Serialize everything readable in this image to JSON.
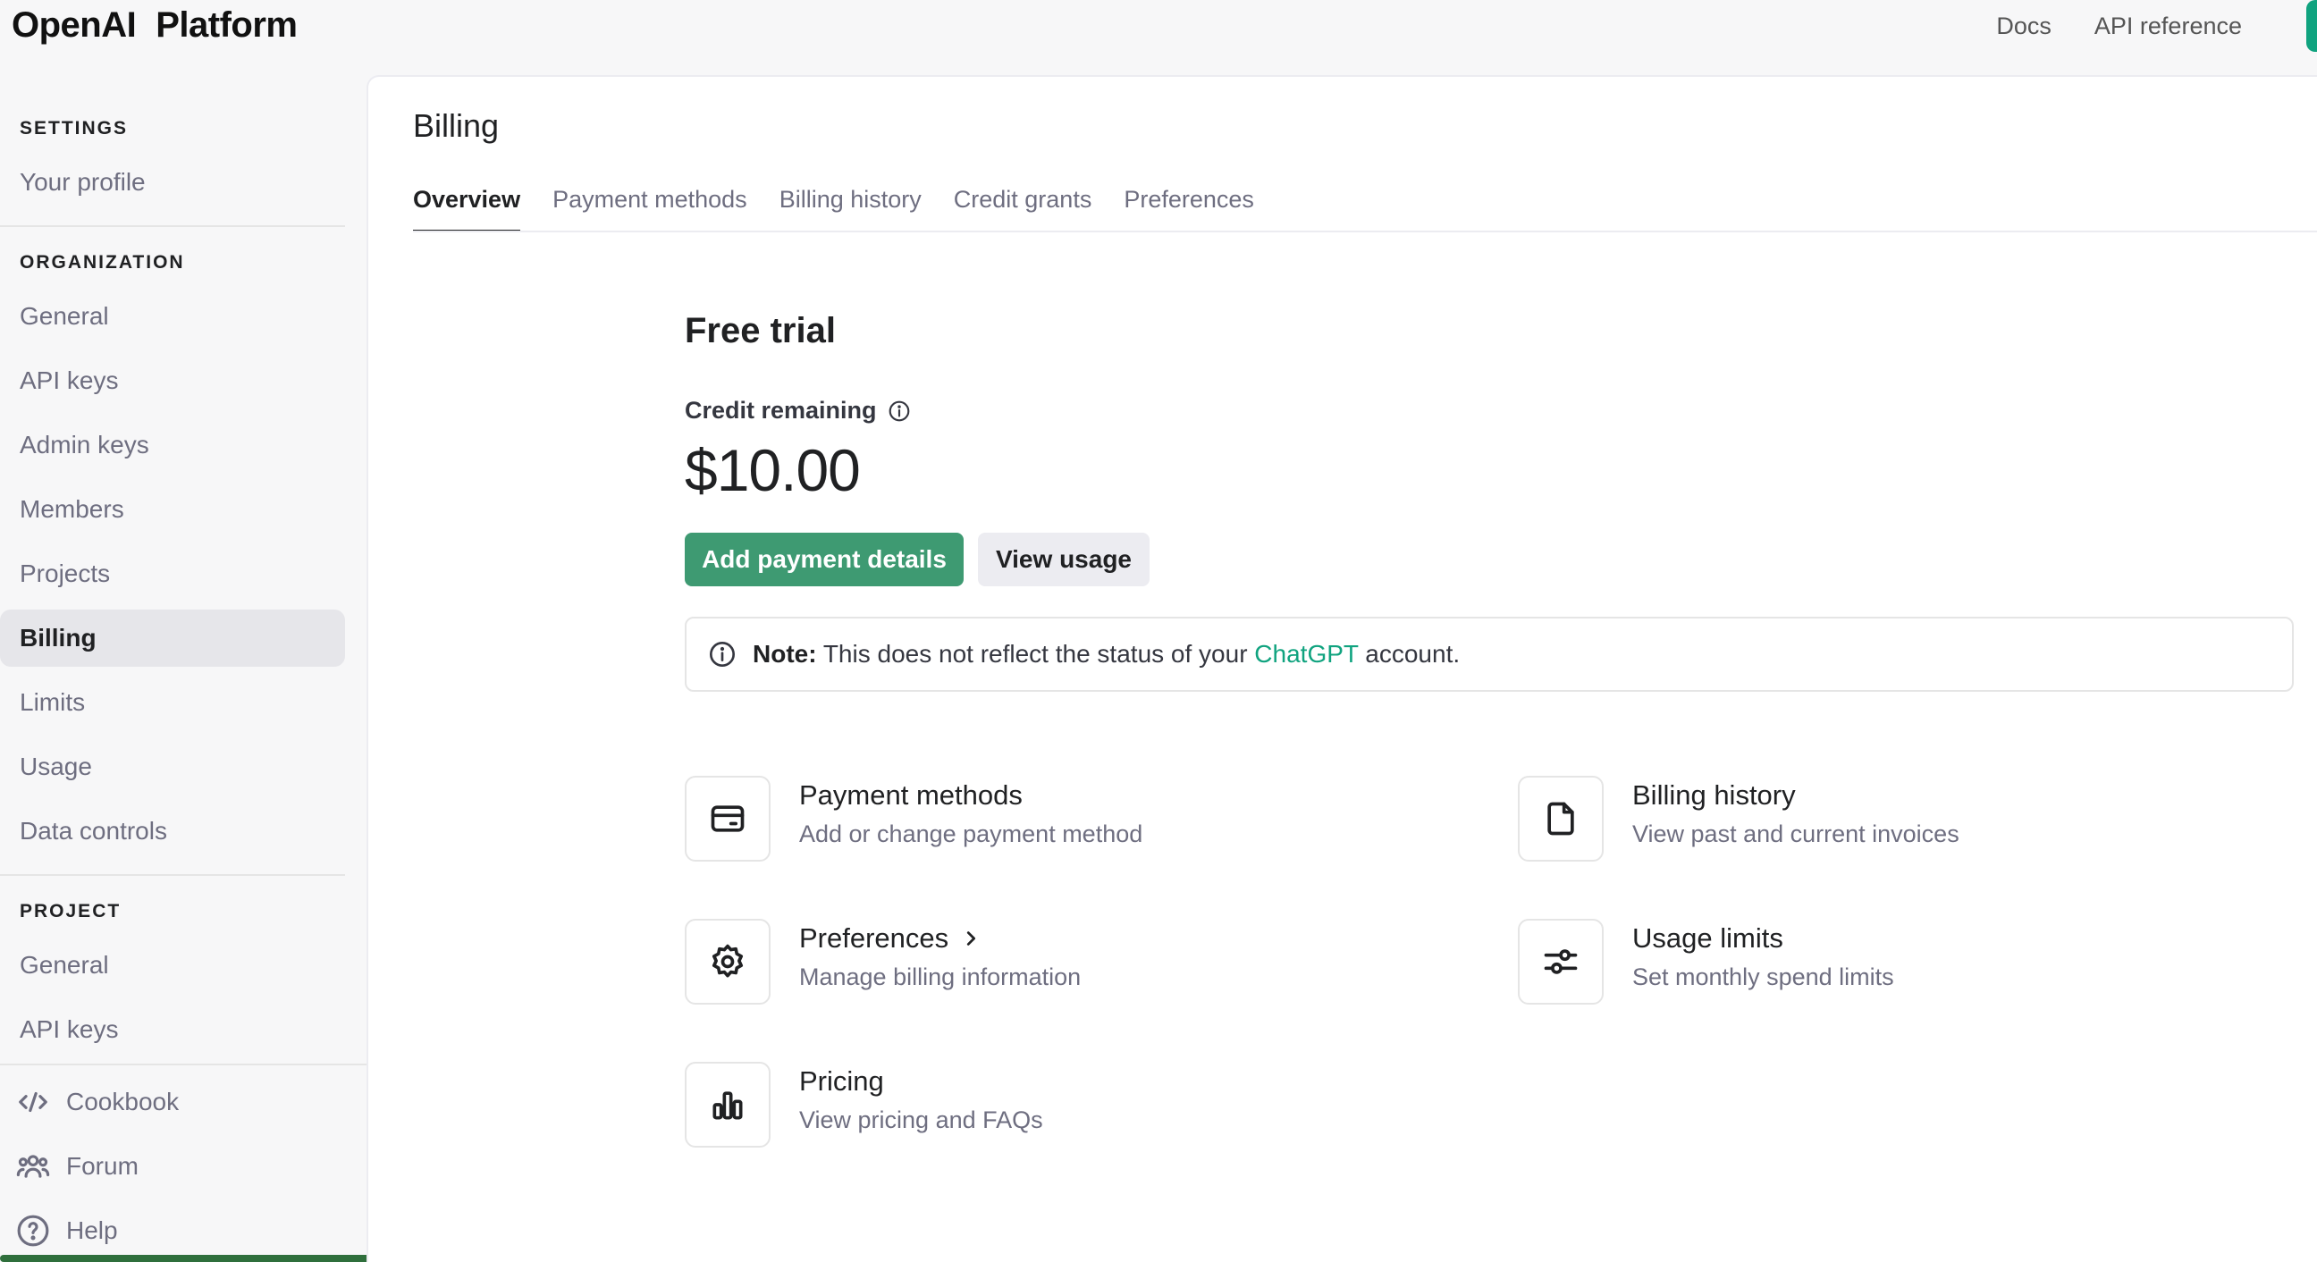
{
  "topbar": {
    "brand": "OpenAI",
    "product": "Platform",
    "links": [
      "Docs",
      "API reference"
    ]
  },
  "sidebar": {
    "settings_heading": "SETTINGS",
    "settings_items": [
      "Your profile"
    ],
    "organization_heading": "ORGANIZATION",
    "organization_items": [
      "General",
      "API keys",
      "Admin keys",
      "Members",
      "Projects",
      "Billing",
      "Limits",
      "Usage",
      "Data controls"
    ],
    "active_item": "Billing",
    "project_heading": "PROJECT",
    "project_items": [
      "General",
      "API keys"
    ],
    "footer_items": [
      {
        "label": "Cookbook",
        "icon": "code-icon"
      },
      {
        "label": "Forum",
        "icon": "users-icon"
      },
      {
        "label": "Help",
        "icon": "help-circle-icon"
      }
    ]
  },
  "main": {
    "title": "Billing",
    "tabs": [
      "Overview",
      "Payment methods",
      "Billing history",
      "Credit grants",
      "Preferences"
    ],
    "active_tab": "Overview",
    "plan_title": "Free trial",
    "credit_label": "Credit remaining",
    "credit_amount": "$10.00",
    "add_payment_label": "Add payment details",
    "view_usage_label": "View usage",
    "note": {
      "prefix": "Note:",
      "text": "This does not reflect the status of your",
      "link": "ChatGPT",
      "suffix": "account."
    },
    "cards": [
      {
        "title": "Payment methods",
        "desc": "Add or change payment method",
        "icon": "credit-card-icon"
      },
      {
        "title": "Billing history",
        "desc": "View past and current invoices",
        "icon": "document-icon"
      },
      {
        "title": "Preferences",
        "desc": "Manage billing information",
        "icon": "gear-icon"
      },
      {
        "title": "Usage limits",
        "desc": "Set monthly spend limits",
        "icon": "sliders-icon"
      },
      {
        "title": "Pricing",
        "desc": "View pricing and FAQs",
        "icon": "bar-chart-icon"
      }
    ]
  },
  "colors": {
    "accent": "#10a37f",
    "button_green": "#3e9a72",
    "active_nav_bg": "#e6e6ea"
  }
}
